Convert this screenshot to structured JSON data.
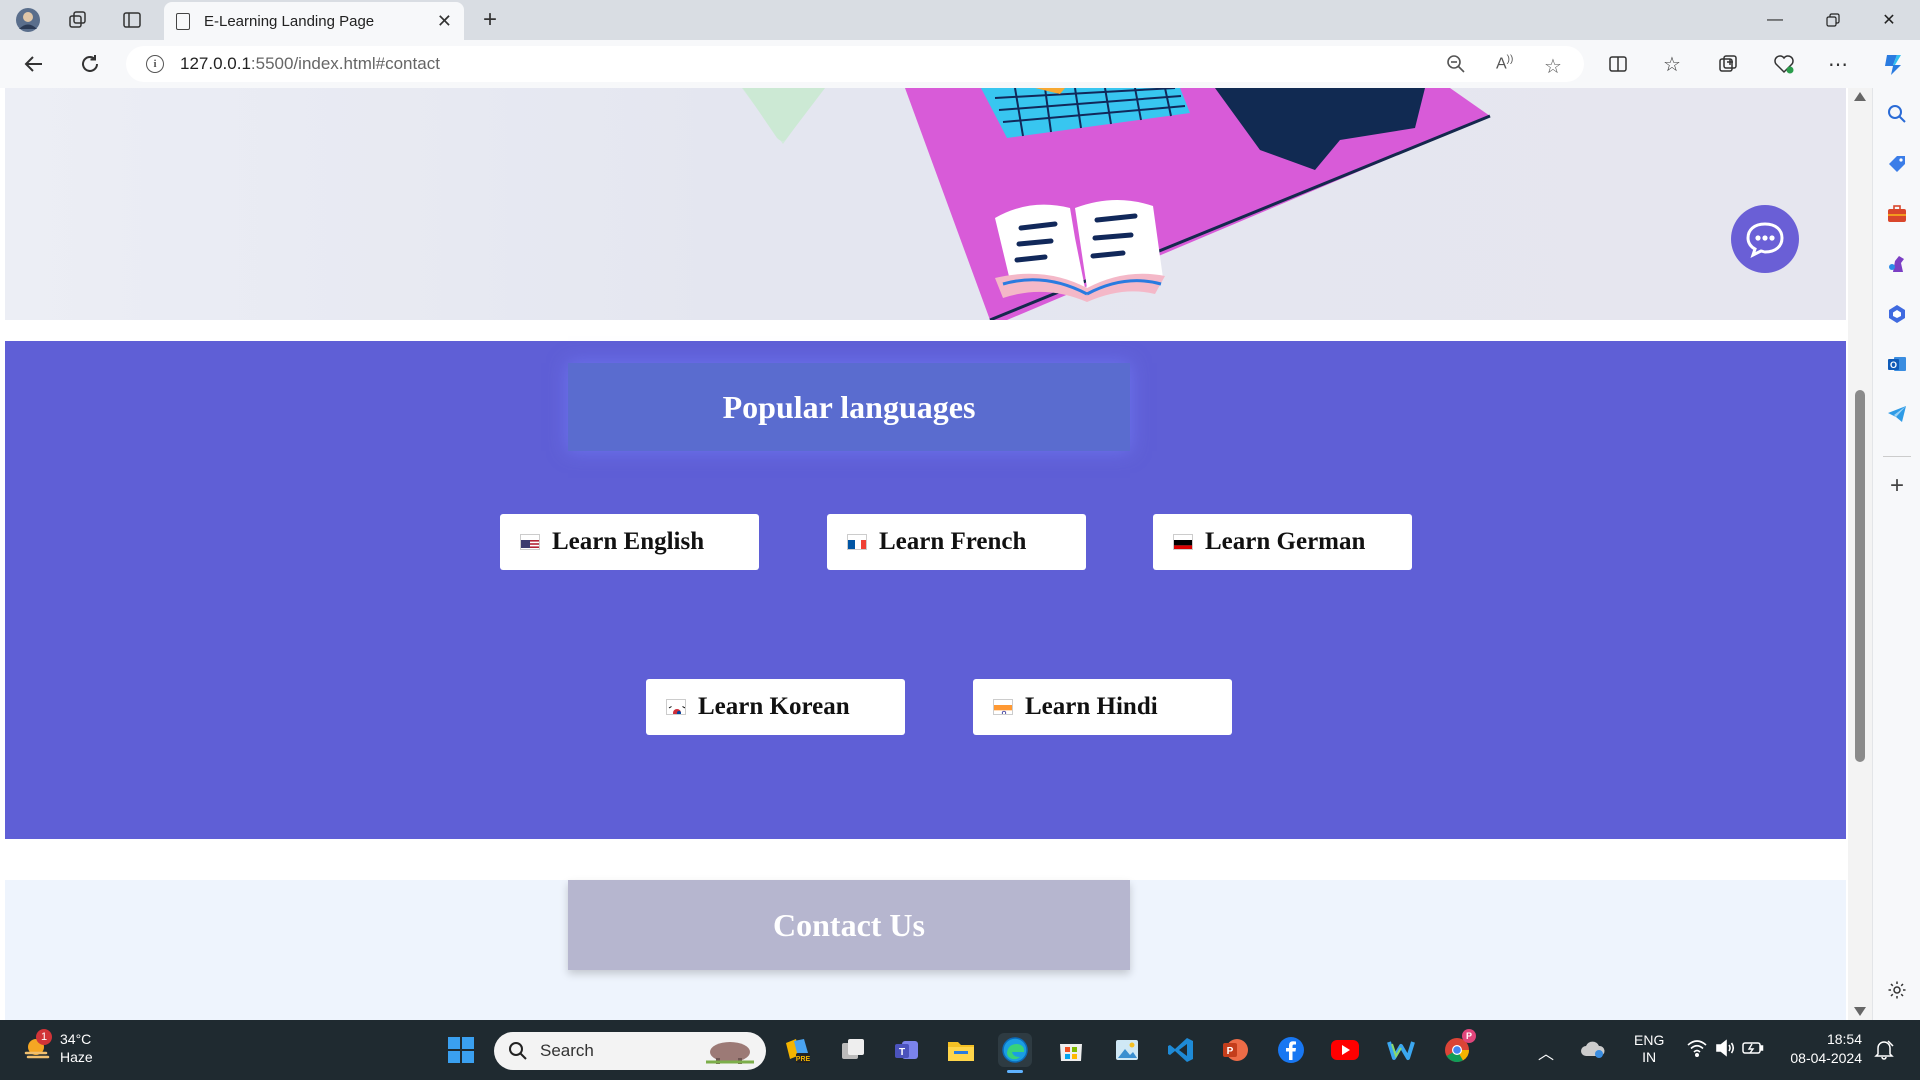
{
  "browser": {
    "tab_title": "E-Learning Landing Page",
    "url_host": "127.0.0.1",
    "url_path": ":5500/index.html#contact"
  },
  "page": {
    "popular_title": "Popular languages",
    "languages": [
      {
        "label": "Learn English",
        "flag": "us"
      },
      {
        "label": "Learn French",
        "flag": "fr"
      },
      {
        "label": "Learn German",
        "flag": "de"
      },
      {
        "label": "Learn Korean",
        "flag": "kr"
      },
      {
        "label": "Learn Hindi",
        "flag": "in"
      }
    ],
    "contact_title": "Contact Us"
  },
  "taskbar": {
    "weather_temp": "34°C",
    "weather_desc": "Haze",
    "weather_badge": "1",
    "search_placeholder": "Search",
    "lang_line1": "ENG",
    "lang_line2": "IN",
    "time": "18:54",
    "date": "08-04-2024"
  },
  "colors": {
    "section_bg": "#5f5fd6",
    "title_box": "#5a6ccf",
    "contact_box": "#b6b6cf",
    "chat_button": "#6a5fd6"
  }
}
